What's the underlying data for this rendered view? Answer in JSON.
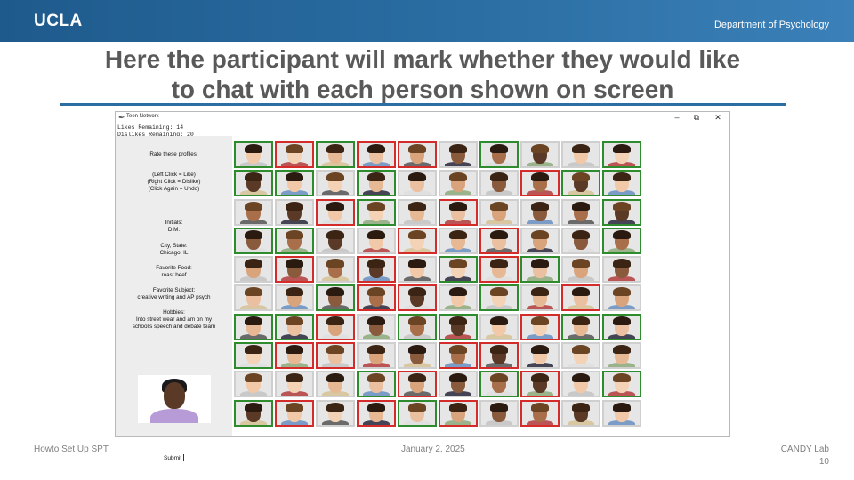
{
  "slide": {
    "logo": "UCLA",
    "department": "Department of Psychology",
    "title_line1": "Here the participant will mark whether they would like",
    "title_line2": "to chat with each person shown on screen",
    "footer_left": "Howto Set Up SPT",
    "footer_center": "January 2, 2025",
    "footer_right": "CANDY Lab",
    "page_number": "10"
  },
  "app": {
    "window_title": "Teen Network",
    "likes_remaining": "Likes Remaining: 14",
    "dislikes_remaining": "Dislikes Remaining: 20",
    "sidebar": {
      "heading": "Rate these profiles!",
      "instructions": [
        "(Left Click = Like)",
        "(Right Click = Dislike)",
        "(Click Again = Undo)"
      ],
      "initials_label": "Initials:",
      "initials_value": "D.M.",
      "city_label": "City, State:",
      "city_value": "Chicago, IL",
      "food_label": "Favorite Food:",
      "food_value": "roast beef",
      "subject_label": "Favorite Subject:",
      "subject_value": "creative writing and AP psych",
      "hobbies_label": "Hobbies:",
      "hobbies_value": [
        "Into street wear and am on my",
        "school's speech and debate team"
      ]
    },
    "submit_label": "Submit",
    "grid_ratings": [
      [
        "like",
        "dislike",
        "like",
        "dislike",
        "dislike",
        "none",
        "like",
        "none",
        "none",
        "like"
      ],
      [
        "like",
        "like",
        "none",
        "like",
        "none",
        "none",
        "none",
        "dislike",
        "like",
        "like"
      ],
      [
        "none",
        "none",
        "dislike",
        "like",
        "none",
        "dislike",
        "none",
        "none",
        "none",
        "like"
      ],
      [
        "like",
        "like",
        "none",
        "none",
        "dislike",
        "none",
        "dislike",
        "none",
        "none",
        "like"
      ],
      [
        "none",
        "dislike",
        "none",
        "dislike",
        "none",
        "like",
        "dislike",
        "like",
        "none",
        "none"
      ],
      [
        "none",
        "none",
        "like",
        "dislike",
        "dislike",
        "none",
        "like",
        "none",
        "dislike",
        "none"
      ],
      [
        "like",
        "like",
        "dislike",
        "none",
        "like",
        "like",
        "none",
        "dislike",
        "like",
        "like"
      ],
      [
        "like",
        "dislike",
        "dislike",
        "none",
        "none",
        "dislike",
        "dislike",
        "none",
        "none",
        "none"
      ],
      [
        "none",
        "none",
        "none",
        "like",
        "dislike",
        "none",
        "like",
        "dislike",
        "none",
        "like"
      ],
      [
        "like",
        "dislike",
        "none",
        "dislike",
        "like",
        "dislike",
        "none",
        "dislike",
        "none",
        "none"
      ]
    ],
    "colors": {
      "like": "#2e8b2e",
      "dislike": "#d42b2b",
      "header_band": "#2a6ea3"
    }
  }
}
